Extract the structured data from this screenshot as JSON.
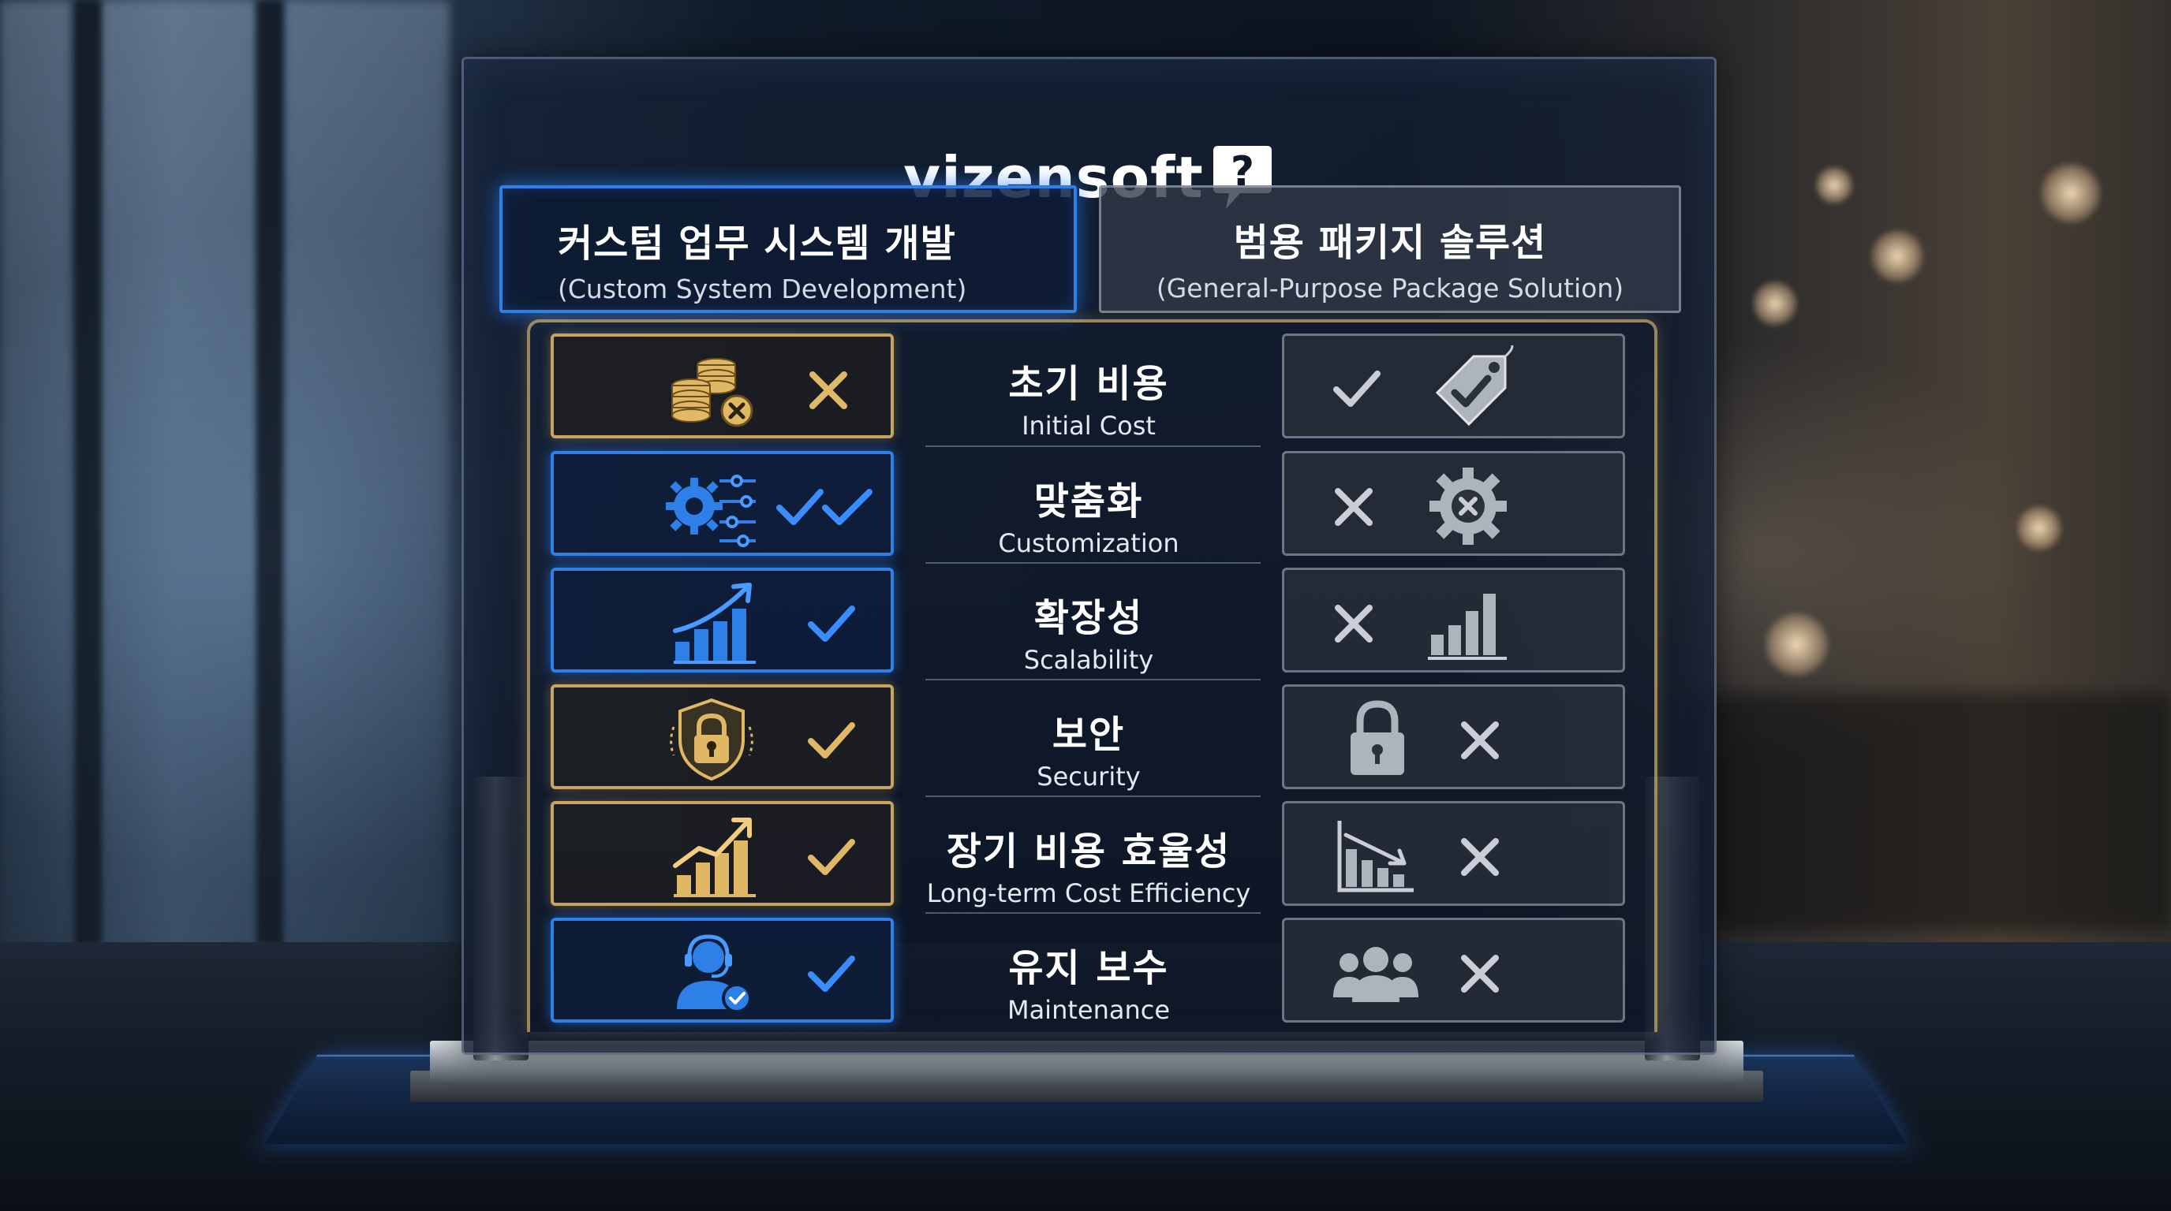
{
  "brand": {
    "name": "vizensoft",
    "icon": "question-speech-bubble-icon"
  },
  "columns": {
    "custom": {
      "title_ko": "커스텀 업무 시스템 개발",
      "title_en": "(Custom System Development)",
      "accent": "#2f7fe8"
    },
    "package": {
      "title_ko": "범용 패키지 솔루션",
      "title_en": "(General-Purpose Package Solution)"
    }
  },
  "rows": [
    {
      "label_ko": "초기 비용",
      "label_en": "Initial Cost",
      "custom": {
        "icon": "coins-cancel-icon",
        "mark": "cross",
        "style": "gold"
      },
      "package": {
        "icon": "price-tag-check-icon",
        "mark": "check"
      }
    },
    {
      "label_ko": "맞춤화",
      "label_en": "Customization",
      "custom": {
        "icon": "gear-settings-icon",
        "mark": "double-check",
        "style": "blue"
      },
      "package": {
        "icon": "gear-cancel-icon",
        "mark": "cross"
      }
    },
    {
      "label_ko": "확장성",
      "label_en": "Scalability",
      "custom": {
        "icon": "growth-chart-icon",
        "mark": "check",
        "style": "blue"
      },
      "package": {
        "icon": "bar-chart-icon",
        "mark": "cross"
      }
    },
    {
      "label_ko": "보안",
      "label_en": "Security",
      "custom": {
        "icon": "shield-lock-icon",
        "mark": "check",
        "style": "gold"
      },
      "package": {
        "icon": "padlock-icon",
        "mark": "cross"
      }
    },
    {
      "label_ko": "장기 비용 효율성",
      "label_en": "Long-term Cost Efficiency",
      "custom": {
        "icon": "rising-chart-icon",
        "mark": "check",
        "style": "gold"
      },
      "package": {
        "icon": "declining-chart-icon",
        "mark": "cross"
      }
    },
    {
      "label_ko": "유지 보수",
      "label_en": "Maintenance",
      "custom": {
        "icon": "support-agent-icon",
        "mark": "check",
        "style": "blue"
      },
      "package": {
        "icon": "user-group-icon",
        "mark": "cross"
      }
    }
  ],
  "colors": {
    "blue": "#2f7fe8",
    "gold": "#e0b865",
    "silver": "#c9ced6"
  }
}
